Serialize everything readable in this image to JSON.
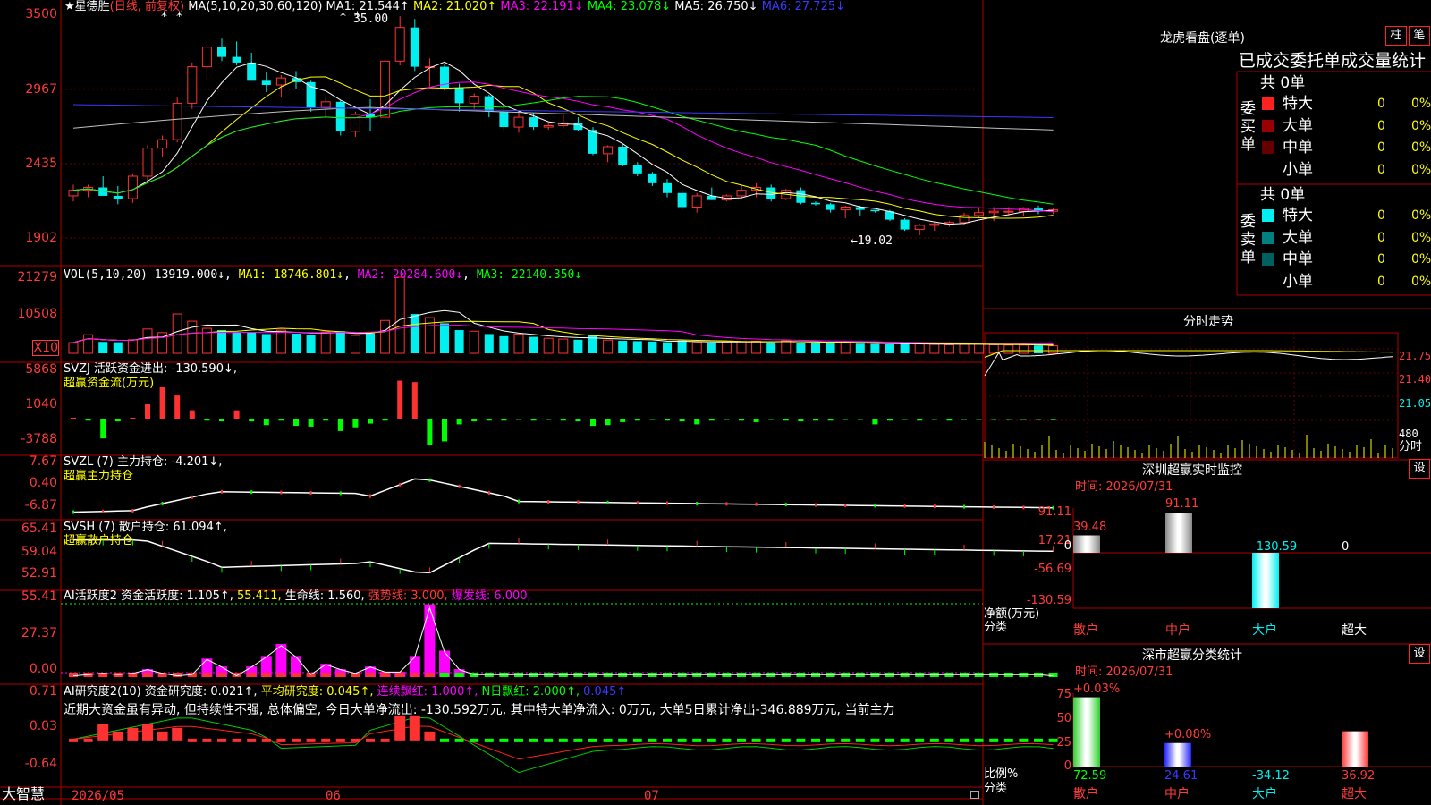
{
  "colors": {
    "up": "#ff3232",
    "down": "#00f0f0",
    "grid": "#b00000",
    "ma1": "#ffffff",
    "ma2": "#ffff00",
    "ma3": "#ff00ff",
    "ma4": "#00ff00",
    "ma5": "#c0c0c0",
    "ma6": "#3a3aff",
    "yellow": "#ffff00",
    "green": "#00ff00",
    "magenta": "#ff00ff"
  },
  "left_labels": {
    "price": [
      "3500",
      "2967",
      "2435",
      "1902"
    ],
    "vol": [
      "21279",
      "10508",
      "X10"
    ],
    "svzj": [
      "5868",
      "1040",
      "-3788"
    ],
    "svzl": [
      "7.67",
      "0.40",
      "-6.87"
    ],
    "svsh": [
      "65.41",
      "59.04",
      "52.91"
    ],
    "ai1": [
      "55.41",
      "27.37",
      "0.00"
    ],
    "ai2": [
      "0.71",
      "0.03",
      "-0.64"
    ]
  },
  "price_header": {
    "stock": "★星德胜",
    "mode": "(日线, 前复权)",
    "ma_def": "MA(5,10,20,30,60,120)",
    "ma": [
      {
        "name": "MA1:",
        "val": "21.544↑"
      },
      {
        "name": "MA2:",
        "val": "21.020↑"
      },
      {
        "name": "MA3:",
        "val": "22.191↓"
      },
      {
        "name": "MA4:",
        "val": "23.078↓"
      },
      {
        "name": "MA5:",
        "val": "26.750↓"
      },
      {
        "name": "MA6:",
        "val": "27.725↓"
      }
    ],
    "high_mark": "35.00",
    "low_mark": "←19.02"
  },
  "vol_header": {
    "def": "VOL(5,10,20)",
    "val": "13919.000↓",
    "ma1": "MA1: 18746.801↓",
    "ma2": "MA2: 20284.600↓",
    "ma3": "MA3: 22140.350↓"
  },
  "svzj_header": {
    "line1": "SVZJ  活跃资金进出: -130.590↓,",
    "line2": "超赢资金流(万元)"
  },
  "svzl_header": {
    "line1": "SVZL (7) 主力持仓: -4.201↓,",
    "line2": "超赢主力持仓"
  },
  "svsh_header": {
    "line1": "SVSH (7) 散户持仓: 61.094↑,",
    "line2": "超赢散户持仓"
  },
  "ai1_header": {
    "a": "AI活跃度2 资金活跃度: 1.105↑,",
    "b": "55.411,",
    "c": "生命线: 1.560,",
    "d": "强势线: 3.000,",
    "e": "爆发线: 6.000,"
  },
  "ai2_header": {
    "a": "AI研究度2(10) 资金研究度: 0.021↑,",
    "b": "平均研究度: 0.045↑,",
    "c": "连续飘红: 1.000↑,",
    "d": "N日飘红: 2.000↑,",
    "e": "0.045↑"
  },
  "ai2_text": "近期大资金虽有异动, 但持续性不强, 总体偏空, 今日大单净流出: -130.592万元, 其中特大单净流入: 0万元, 大单5日累计净出-346.889万元, 当前主力",
  "bottom": {
    "brand": "大智慧",
    "dates": [
      "2026/05",
      "06",
      "07"
    ]
  },
  "lhb": {
    "title": "龙虎看盘(逐单)",
    "btn1": "柱",
    "btn2": "笔",
    "stats_title": "已成交委托单成交量统计",
    "buy": {
      "label": "委买单",
      "count": "共 0单",
      "rows": [
        {
          "name": "特大",
          "qty": "0",
          "pct": "0%"
        },
        {
          "name": "大单",
          "qty": "0",
          "pct": "0%"
        },
        {
          "name": "中单",
          "qty": "0",
          "pct": "0%"
        },
        {
          "name": "小单",
          "qty": "0",
          "pct": "0%"
        }
      ]
    },
    "sell": {
      "label": "委卖单",
      "count": "共 0单",
      "rows": [
        {
          "name": "特大",
          "qty": "0",
          "pct": "0%"
        },
        {
          "name": "大单",
          "qty": "0",
          "pct": "0%"
        },
        {
          "name": "中单",
          "qty": "0",
          "pct": "0%"
        },
        {
          "name": "小单",
          "qty": "0",
          "pct": "0%"
        }
      ]
    }
  },
  "intraday": {
    "title": "分时走势",
    "p": [
      "21.75",
      "21.40",
      "21.05"
    ],
    "vol": "480",
    "vol_unit": "分时"
  },
  "sz_monitor": {
    "title": "深圳超赢实时监控",
    "btn": "设",
    "time": "时间: 2026/07/31",
    "y": [
      "91.11",
      "17.21",
      "0",
      "-56.69",
      "-130.59"
    ],
    "bars": [
      {
        "cat": "散户",
        "val": "39.48"
      },
      {
        "cat": "中户",
        "val": "91.11"
      },
      {
        "cat": "大户",
        "val": "-130.59"
      },
      {
        "cat": "超大",
        "val": "0"
      }
    ],
    "ylabel": "净额(万元)",
    "xlabel": "分类"
  },
  "sz_class": {
    "title": "深市超赢分类统计",
    "btn": "设",
    "time": "时间: 2026/07/31",
    "y": [
      "75",
      "50",
      "25",
      "0"
    ],
    "bars": [
      {
        "cat": "散户",
        "val": "72.59",
        "pct": "+0.03%"
      },
      {
        "cat": "中户",
        "val": "24.61",
        "pct": "+0.08%"
      },
      {
        "cat": "大户",
        "val": "-34.12",
        "pct": ""
      },
      {
        "cat": "超大",
        "val": "36.92",
        "pct": ""
      }
    ],
    "ylabel": "比例%",
    "xlabel": "分类"
  },
  "chart_data": [
    {
      "type": "candlestick",
      "title": "星德胜 日线",
      "ylim": [
        19.0,
        35.0
      ],
      "ohlc": [
        [
          22.0,
          22.8,
          21.6,
          22.4
        ],
        [
          22.4,
          22.8,
          21.9,
          22.6
        ],
        [
          22.6,
          23.4,
          22.2,
          22.0
        ],
        [
          22.0,
          22.7,
          21.4,
          21.8
        ],
        [
          21.8,
          23.6,
          21.5,
          23.4
        ],
        [
          23.4,
          25.6,
          23.0,
          25.4
        ],
        [
          25.4,
          26.3,
          24.8,
          26.0
        ],
        [
          26.0,
          29.0,
          25.8,
          28.6
        ],
        [
          28.6,
          31.5,
          28.2,
          31.2
        ],
        [
          31.2,
          32.8,
          30.2,
          32.6
        ],
        [
          32.6,
          33.2,
          31.6,
          31.9
        ],
        [
          31.9,
          33.0,
          31.3,
          31.5
        ],
        [
          31.5,
          32.2,
          30.2,
          30.2
        ],
        [
          30.2,
          30.8,
          29.4,
          29.9
        ],
        [
          29.9,
          30.6,
          29.0,
          30.4
        ],
        [
          30.4,
          30.9,
          29.6,
          30.1
        ],
        [
          30.1,
          30.2,
          28.0,
          28.3
        ],
        [
          28.3,
          29.0,
          27.6,
          28.7
        ],
        [
          28.7,
          28.8,
          26.3,
          26.6
        ],
        [
          26.6,
          28.0,
          26.2,
          27.8
        ],
        [
          27.8,
          28.9,
          26.6,
          27.6
        ],
        [
          27.6,
          31.8,
          27.2,
          31.6
        ],
        [
          31.6,
          34.8,
          31.3,
          34.0
        ],
        [
          34.0,
          34.6,
          30.9,
          31.2
        ],
        [
          31.2,
          31.8,
          29.8,
          31.2
        ],
        [
          31.2,
          31.4,
          29.5,
          29.7
        ],
        [
          29.7,
          30.0,
          28.0,
          28.6
        ],
        [
          28.6,
          29.3,
          28.2,
          29.1
        ],
        [
          29.1,
          29.2,
          27.6,
          28.0
        ],
        [
          28.0,
          28.4,
          26.6,
          26.9
        ],
        [
          26.9,
          28.1,
          26.5,
          27.6
        ],
        [
          27.6,
          27.9,
          26.7,
          26.9
        ],
        [
          26.9,
          27.2,
          26.7,
          27.0
        ],
        [
          27.0,
          27.9,
          26.8,
          27.2
        ],
        [
          27.2,
          27.6,
          26.6,
          26.7
        ],
        [
          26.7,
          26.9,
          24.9,
          25.0
        ],
        [
          25.0,
          25.6,
          24.4,
          25.5
        ],
        [
          25.5,
          25.7,
          24.1,
          24.2
        ],
        [
          24.2,
          24.4,
          23.4,
          23.6
        ],
        [
          23.6,
          23.7,
          22.7,
          22.9
        ],
        [
          22.9,
          23.2,
          21.9,
          22.2
        ],
        [
          22.2,
          22.5,
          21.0,
          21.2
        ],
        [
          21.2,
          22.2,
          20.8,
          22.0
        ],
        [
          22.0,
          22.6,
          21.7,
          21.7
        ],
        [
          21.7,
          22.1,
          21.6,
          22.0
        ],
        [
          22.0,
          22.8,
          21.8,
          22.4
        ],
        [
          22.4,
          22.9,
          21.9,
          22.6
        ],
        [
          22.6,
          22.8,
          21.6,
          21.8
        ],
        [
          21.8,
          22.5,
          21.7,
          22.4
        ],
        [
          22.4,
          22.6,
          21.4,
          21.5
        ],
        [
          21.5,
          21.6,
          21.3,
          21.4
        ],
        [
          21.4,
          21.5,
          20.8,
          21.0
        ],
        [
          21.0,
          21.3,
          20.4,
          21.2
        ],
        [
          21.2,
          21.3,
          20.6,
          21.0
        ],
        [
          21.0,
          21.0,
          20.8,
          20.9
        ],
        [
          20.9,
          21.0,
          20.2,
          20.3
        ],
        [
          20.3,
          20.4,
          19.5,
          19.6
        ],
        [
          19.6,
          20.0,
          19.2,
          19.9
        ],
        [
          19.9,
          20.1,
          19.5,
          20.0
        ],
        [
          20.0,
          20.2,
          19.8,
          20.1
        ],
        [
          20.1,
          20.8,
          19.9,
          20.6
        ],
        [
          20.6,
          21.2,
          20.4,
          20.8
        ],
        [
          20.8,
          21.2,
          20.2,
          20.9
        ],
        [
          20.9,
          21.2,
          20.6,
          20.9
        ],
        [
          20.9,
          21.2,
          20.6,
          21.1
        ],
        [
          21.1,
          21.3,
          20.7,
          20.9
        ],
        [
          20.9,
          21.1,
          20.7,
          21.0
        ]
      ],
      "ma_series": [
        {
          "name": "MA1",
          "last": 21.544
        },
        {
          "name": "MA2",
          "last": 21.02
        },
        {
          "name": "MA3",
          "last": 22.191
        },
        {
          "name": "MA4",
          "last": 23.078
        },
        {
          "name": "MA5",
          "last": 26.75
        },
        {
          "name": "MA6",
          "last": 27.725
        }
      ]
    },
    {
      "type": "bar",
      "title": "VOL",
      "ylim": [
        0,
        21279
      ],
      "values": [
        3000,
        5200,
        3200,
        3100,
        3800,
        6800,
        5800,
        11000,
        9000,
        7000,
        6500,
        6000,
        6000,
        5400,
        6500,
        5500,
        5200,
        6000,
        6200,
        5000,
        5600,
        9200,
        21279,
        11000,
        10000,
        8400,
        6500,
        6200,
        5400,
        4800,
        5400,
        4600,
        4200,
        4000,
        3800,
        5000,
        3700,
        3500,
        3400,
        3300,
        3100,
        3600,
        3000,
        3000,
        3200,
        3300,
        3400,
        3000,
        3600,
        3000,
        2900,
        2800,
        3000,
        2700,
        2600,
        2500,
        2700,
        2600,
        2500,
        2400,
        2500,
        2600,
        2400,
        2300,
        2300,
        2200,
        2100
      ]
    },
    {
      "type": "bar",
      "title": "超赢资金流(万元)",
      "ylim": [
        -3788,
        5868
      ],
      "values": [
        200,
        -200,
        -2600,
        -300,
        200,
        2000,
        4300,
        3200,
        1200,
        -200,
        -300,
        1200,
        -300,
        -800,
        -200,
        -900,
        -1000,
        -200,
        -1600,
        -1100,
        -600,
        -200,
        5200,
        5000,
        -3500,
        -3000,
        -700,
        -300,
        -200,
        -200,
        -100,
        -200,
        -100,
        -200,
        -300,
        -900,
        -800,
        -400,
        -200,
        -100,
        -200,
        -300,
        -700,
        -200,
        -100,
        -200,
        -400,
        -100,
        -200,
        -300,
        -200,
        -200,
        -100,
        -100,
        -700,
        -200,
        -100,
        -200,
        -100,
        -200,
        -100,
        -100,
        -100,
        -100,
        -100,
        -100,
        -130
      ]
    },
    {
      "type": "line",
      "title": "超赢主力持仓",
      "ylim": [
        -6.87,
        7.67
      ],
      "last": -4.201
    },
    {
      "type": "line",
      "title": "超赢散户持仓",
      "ylim": [
        52.91,
        65.41
      ],
      "last": 61.094
    },
    {
      "type": "bar",
      "title": "AI活跃度2",
      "ylim": [
        0,
        55.41
      ],
      "values": [
        1,
        2,
        3,
        2,
        3,
        6,
        3,
        1,
        2,
        14,
        8,
        1,
        8,
        16,
        25,
        16,
        2,
        10,
        6,
        3,
        8,
        4,
        4,
        16,
        55,
        20,
        6,
        2,
        2,
        2,
        2,
        2,
        2,
        2,
        2,
        2,
        2,
        2,
        2,
        2,
        2,
        2,
        2,
        2,
        2,
        2,
        2,
        2,
        2,
        2,
        2,
        2,
        2,
        2,
        2,
        2,
        2,
        2,
        2,
        2,
        2,
        2,
        2,
        2,
        2,
        2,
        1
      ]
    },
    {
      "type": "line",
      "title": "AI研究度2",
      "ylim": [
        -0.64,
        0.71
      ],
      "last": 0.021,
      "avg": 0.045
    }
  ]
}
